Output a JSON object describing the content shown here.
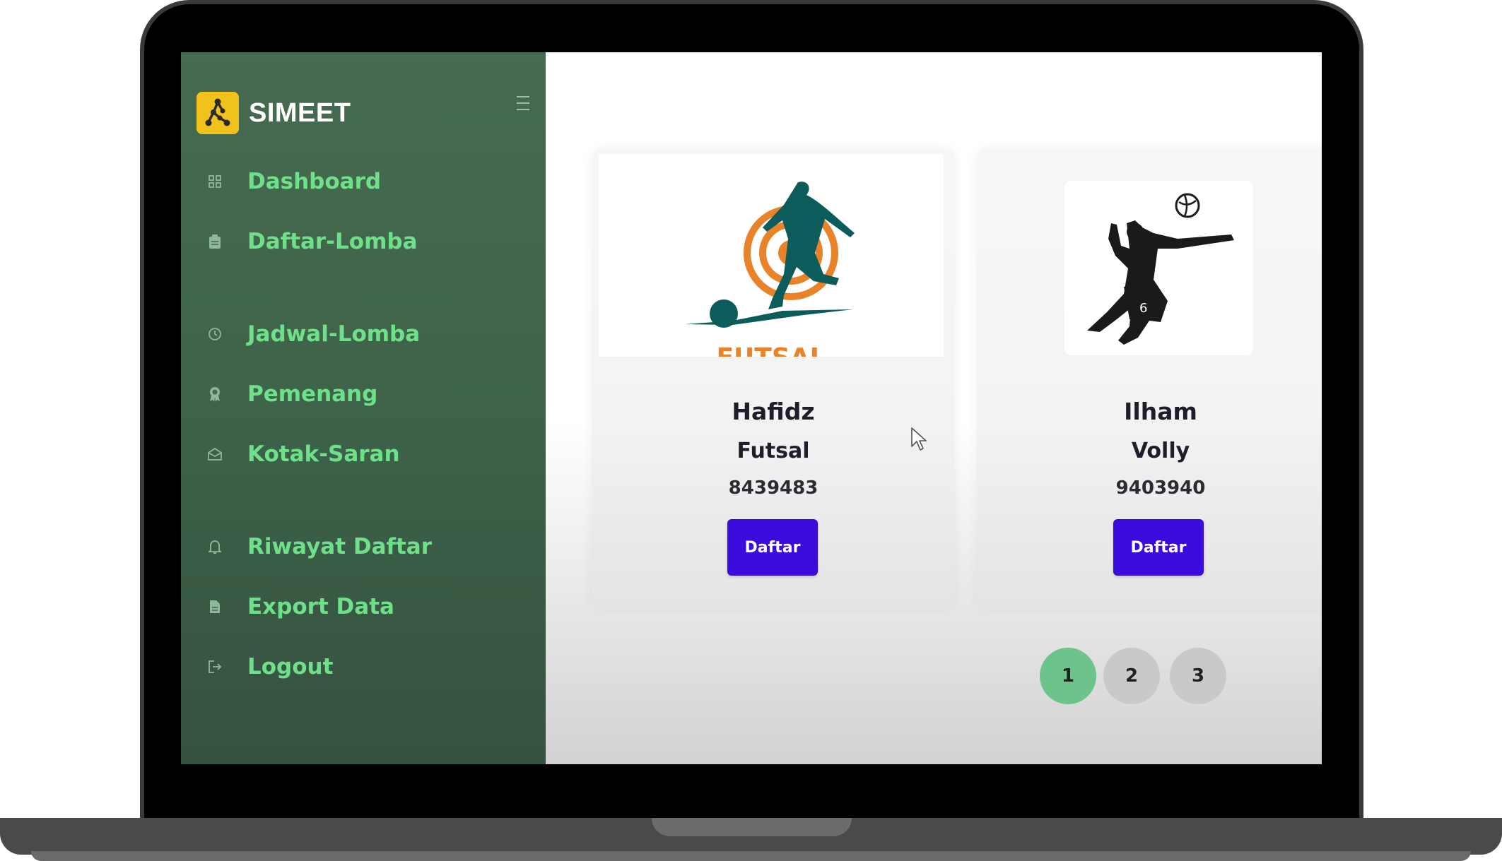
{
  "brand": {
    "name": "SIMEET",
    "logo_icon": "network-nodes-icon",
    "logo_color": "#f2c21c"
  },
  "sidebar": {
    "items": [
      {
        "label": "Dashboard",
        "icon": "grid-icon"
      },
      {
        "label": "Daftar-Lomba",
        "icon": "clipboard-icon"
      },
      {
        "label": "Jadwal-Lomba",
        "icon": "clock-icon"
      },
      {
        "label": "Pemenang",
        "icon": "award-icon"
      },
      {
        "label": "Kotak-Saran",
        "icon": "mail-open-icon"
      },
      {
        "label": "Riwayat Daftar",
        "icon": "bell-icon"
      },
      {
        "label": "Export Data",
        "icon": "file-icon"
      },
      {
        "label": "Logout",
        "icon": "logout-icon"
      }
    ],
    "label_color": "#6fe08a"
  },
  "cards": [
    {
      "name": "Hafidz",
      "sport": "Futsal",
      "code": "8439483",
      "button_label": "Daftar",
      "image_icon": "futsal-player-icon"
    },
    {
      "name": "Ilham",
      "sport": "Volly",
      "code": "9403940",
      "button_label": "Daftar",
      "image_icon": "volleyball-player-icon"
    }
  ],
  "pagination": {
    "pages": [
      "1",
      "2",
      "3"
    ],
    "current": "1",
    "active_color": "#6cc48a"
  },
  "colors": {
    "button": "#3a0bdc",
    "sidebar": "#42664d"
  }
}
